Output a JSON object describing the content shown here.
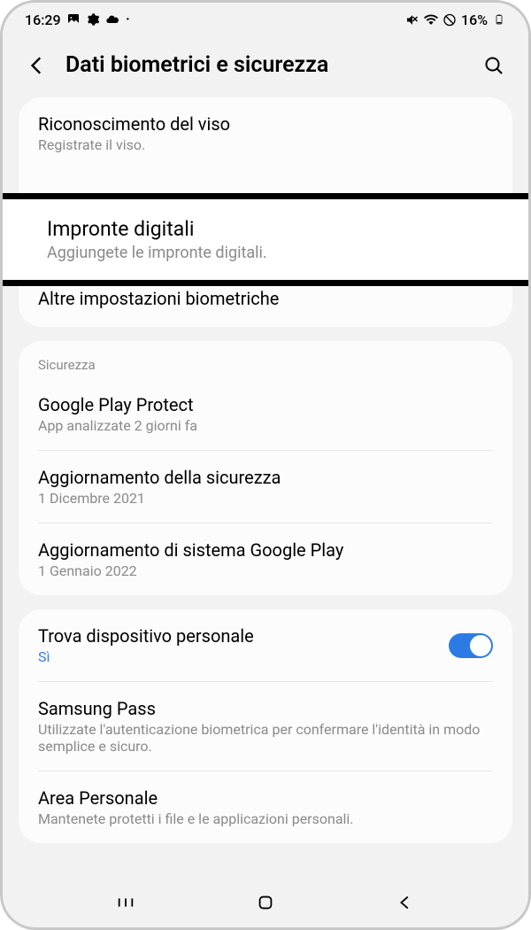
{
  "status": {
    "time": "16:29",
    "battery": "16%"
  },
  "header": {
    "title": "Dati biometrici e sicurezza"
  },
  "biometrics": {
    "face": {
      "title": "Riconoscimento del viso",
      "sub": "Registrate il viso."
    },
    "fingerprint": {
      "title": "Impronte digitali",
      "sub": "Aggiungete le impronte digitali."
    },
    "more": {
      "title": "Altre impostazioni biometriche"
    }
  },
  "security": {
    "header": "Sicurezza",
    "play_protect": {
      "title": "Google Play Protect",
      "sub": "App analizzate 2 giorni fa"
    },
    "security_update": {
      "title": "Aggiornamento della sicurezza",
      "sub": "1 Dicembre 2021"
    },
    "google_system": {
      "title": "Aggiornamento di sistema Google Play",
      "sub": "1 Gennaio 2022"
    }
  },
  "device": {
    "find": {
      "title": "Trova dispositivo personale",
      "status": "Sì"
    },
    "samsung_pass": {
      "title": "Samsung Pass",
      "sub": "Utilizzate l'autenticazione biometrica per confermare l'identità in modo semplice e sicuro."
    },
    "secure_folder": {
      "title": "Area Personale",
      "sub": "Mantenete protetti i file e le applicazioni personali."
    }
  }
}
